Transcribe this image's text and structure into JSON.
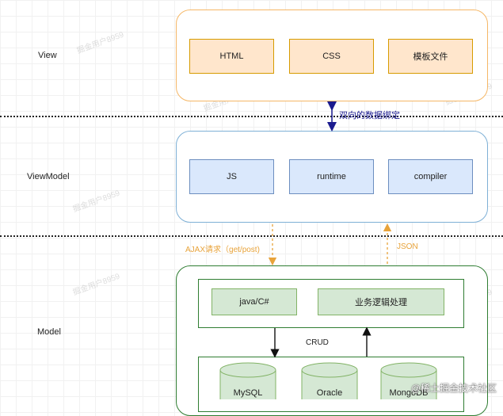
{
  "layers": {
    "view": "View",
    "viewmodel": "ViewModel",
    "model": "Model"
  },
  "view_boxes": [
    "HTML",
    "CSS",
    "模板文件"
  ],
  "viewmodel_boxes": [
    "JS",
    "runtime",
    "compiler"
  ],
  "model_boxes": [
    "java/C#",
    "业务逻辑处理"
  ],
  "databases": [
    "MySQL",
    "Oracle",
    "MongoDB"
  ],
  "labels": {
    "binding": "双向的数据绑定",
    "ajax": "AJAX请求（get/post)",
    "json": "JSON",
    "crud": "CRUD"
  },
  "watermarks": [
    "掘金用户8959"
  ],
  "corner_watermark": "@稀土掘金技术社区",
  "colors": {
    "view_border": "#f5b766",
    "viewmodel_border": "#7eb0d6",
    "model_border": "#2f7d32",
    "binding_arrow": "#1b1b8f",
    "ajax_arrow": "#e8a33a"
  }
}
